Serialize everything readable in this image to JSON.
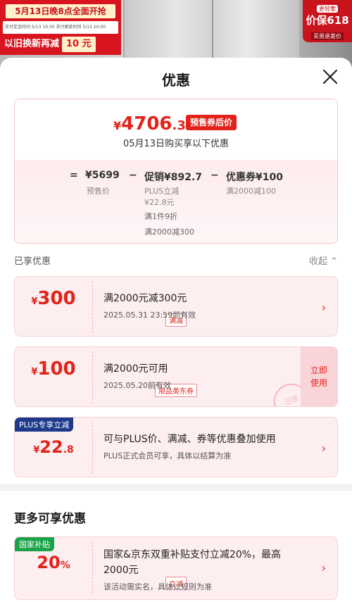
{
  "background": {
    "promo_line1": "5月13日晚8点全面开抢",
    "promo_line2": "支付定金时间 5/13 19:30   支付尾款时间 5/13 20:00",
    "promo_line3_text": "以旧换新再减",
    "promo_line3_amount": "10 元",
    "badge_top": "更轻奢",
    "badge_main": "价保618",
    "badge_sub": "买贵退差价"
  },
  "sheet": {
    "title": "优惠",
    "summary": {
      "price_symbol": "¥",
      "price_int": "4706",
      "price_dec": ".3",
      "price_tag": "预售券后价",
      "date_text": "05月13日购买享以下优惠",
      "eq": "=",
      "presale_price": "¥5699",
      "presale_label": "预售价",
      "minus1": "−",
      "promo_label": "促销¥892.7",
      "plus_line1": "PLUS立减",
      "plus_line2": "¥22.8元",
      "detail_line1": "满1件9折",
      "detail_line2": "满2000减300",
      "minus2": "−",
      "coupon_label": "优惠券¥100",
      "coupon_detail": "满2000减100"
    },
    "enjoyed_label": "已享优惠",
    "collapse_label": "收起",
    "coupons": [
      {
        "amount_symbol": "¥",
        "amount": "300",
        "kind": "满减",
        "title": "满2000元减300元",
        "sub": "2025.05.31  23:59前有效"
      },
      {
        "amount_symbol": "¥",
        "amount": "100",
        "kind": "限品类东券",
        "title": "满2000元可用",
        "sub": "2025.05.20前有效",
        "use_line1": "立即",
        "use_line2": "使用",
        "stamp": "已领"
      },
      {
        "corner": "PLUS专享立减",
        "amount_symbol": "¥",
        "amount": "22",
        "amount_dec": ".8",
        "title": "可与PLUS价、满减、券等优惠叠加使用",
        "sub": "PLUS正式会员可享，具体以结算为准"
      }
    ],
    "more_title": "更多可享优惠",
    "more_items": [
      {
        "corner": "国家补贴",
        "amount": "20",
        "amount_unit": "%",
        "kind": "立减",
        "title_line1": "国家&京东双重补贴支付立减20%，最高",
        "title_line2": "2000元",
        "sub": "该活动需实名，具体以规则为准"
      }
    ],
    "colors": {
      "accent": "#e2231a",
      "coupon_bg": "#fdeef0",
      "plus_tag": "#1d3a8a",
      "subsidy_tag": "#1aa34a"
    }
  }
}
